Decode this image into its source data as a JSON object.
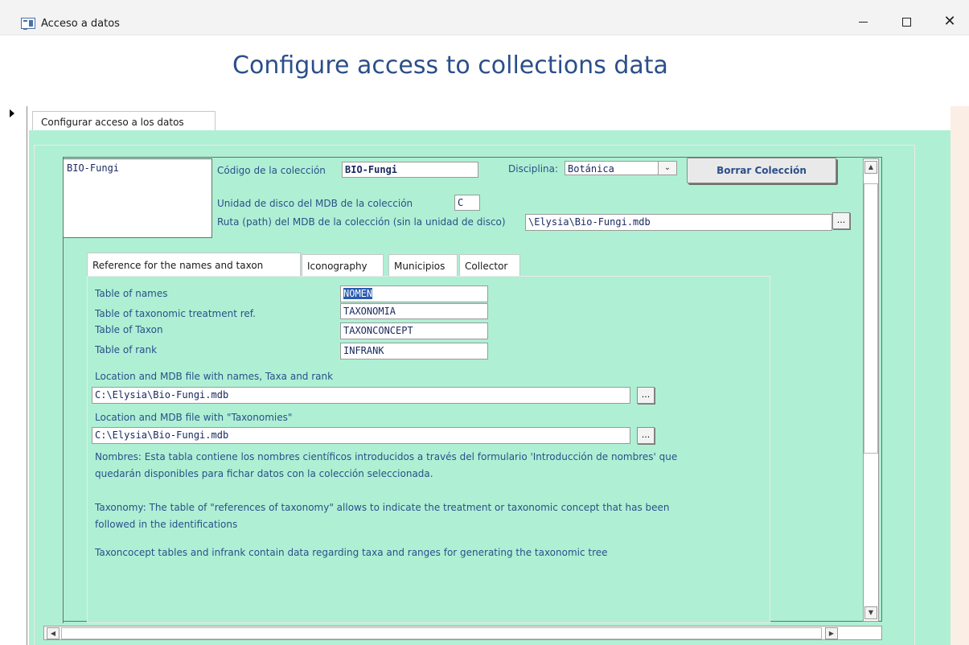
{
  "window": {
    "title": "Acceso a datos",
    "minimize_label": "",
    "maximize_label": "",
    "close_label": "✕"
  },
  "page": {
    "title": "Configure access to collections data"
  },
  "outer_tab": {
    "label": "Configurar acceso a los datos"
  },
  "collection": {
    "list_item": "BIO-Fungi",
    "code_label": "Código de la colección",
    "code_value": "BIO-Fungi",
    "discipline_label": "Disciplina:",
    "discipline_value": "Botánica",
    "delete_button": "Borrar Colección",
    "drive_label": "Unidad de disco del MDB de la colección",
    "drive_value": "C",
    "path_label": "Ruta (path) del MDB de la colección (sin la unidad de disco)",
    "path_value": "\\Elysia\\Bio-Fungi.mdb",
    "browse_label": "..."
  },
  "inner_tabs": [
    {
      "label": "Reference for the names and taxon"
    },
    {
      "label": "Iconography"
    },
    {
      "label": "Municipios"
    },
    {
      "label": "Collector"
    }
  ],
  "names_tab": {
    "table_names_label": "Table of names",
    "table_names_value": "NOMEN",
    "table_taxonomic_label": "Table of taxonomic treatment ref.",
    "table_taxonomic_value": "TAXONOMIA",
    "table_taxon_label": "Table of Taxon",
    "table_taxon_value": "TAXONCONCEPT",
    "table_rank_label": "Table of rank",
    "table_rank_value": "INFRANK",
    "location_names_label": "Location and MDB file with names, Taxa and rank",
    "location_names_value": "C:\\Elysia\\Bio-Fungi.mdb",
    "location_taxonomies_label": "Location and MDB file with \"Taxonomies\"",
    "location_taxonomies_value": "C:\\Elysia\\Bio-Fungi.mdb",
    "browse_label": "...",
    "desc_names": "Nombres: Esta tabla contiene los nombres científicos introducidos a través del formulario 'Introducción de nombres' que quedarán disponibles para fichar datos con la colección seleccionada.",
    "desc_taxonomy": "Taxonomy: The table of \"references of taxonomy\" allows to indicate the treatment or taxonomic concept that has been followed in the identifications",
    "desc_taxoncocept": "Taxoncocept tables and infrank contain data regarding taxa and ranges for generating the taxonomic tree"
  },
  "colors": {
    "panel_bg": "#aff0d4",
    "label_text": "#2b4f8a",
    "side_strip": "#fbeee4"
  }
}
